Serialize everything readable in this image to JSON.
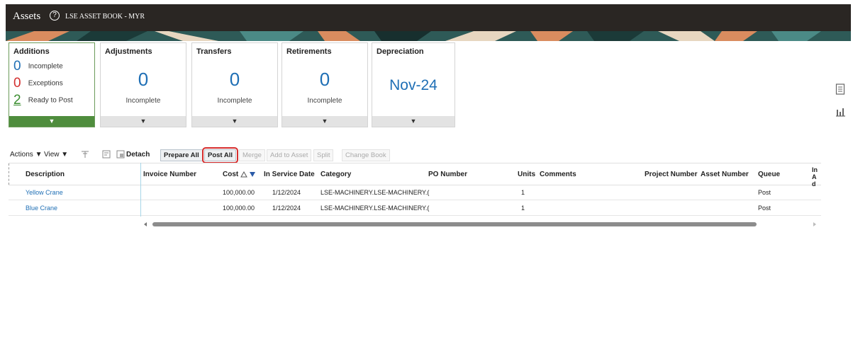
{
  "header": {
    "app_title": "Assets",
    "help_glyph": "?",
    "book": "LSE ASSET BOOK - MYR"
  },
  "cards": {
    "additions": {
      "title": "Additions",
      "rows": [
        {
          "count": "0",
          "label": "Incomplete",
          "color": "#1f6fb5"
        },
        {
          "count": "0",
          "label": "Exceptions",
          "color": "#d32f2f"
        },
        {
          "count": "2",
          "label": "Ready to Post",
          "color": "#3a8d2f"
        }
      ]
    },
    "adjustments": {
      "title": "Adjustments",
      "value": "0",
      "sub": "Incomplete"
    },
    "transfers": {
      "title": "Transfers",
      "value": "0",
      "sub": "Incomplete"
    },
    "retirements": {
      "title": "Retirements",
      "value": "0",
      "sub": "Incomplete"
    },
    "depreciation": {
      "title": "Depreciation",
      "value": "Nov-24"
    },
    "dropdown_glyph": "▼"
  },
  "toolbar": {
    "actions": "Actions ▼",
    "view": "View ▼",
    "detach": "Detach",
    "prepare_all": "Prepare All",
    "post_all": "Post All",
    "merge": "Merge",
    "add_to_asset": "Add to Asset",
    "split": "Split",
    "change_book": "Change Book"
  },
  "table": {
    "columns": [
      "Description",
      "Invoice Number",
      "Cost",
      "In Service Date",
      "Category",
      "PO Number",
      "Units",
      "Comments",
      "Project Number",
      "Asset Number",
      "Queue",
      "In Ad"
    ],
    "rows": [
      {
        "description": "Yellow Crane",
        "cost": "100,000.00",
        "date": "1/12/2024",
        "category": "LSE-MACHINERY.LSE-MACHINERY.(",
        "units": "1",
        "queue": "Post"
      },
      {
        "description": "Blue Crane",
        "cost": "100,000.00",
        "date": "1/12/2024",
        "category": "LSE-MACHINERY.LSE-MACHINERY.(",
        "units": "1",
        "queue": "Post"
      }
    ]
  },
  "side": {
    "icons": [
      "document-icon",
      "chart-icon"
    ]
  },
  "colors": {
    "header_bg": "#2a2623",
    "accent": "#1f6fb5",
    "selected": "#4f8d3d",
    "highlight": "#d62d2d"
  }
}
